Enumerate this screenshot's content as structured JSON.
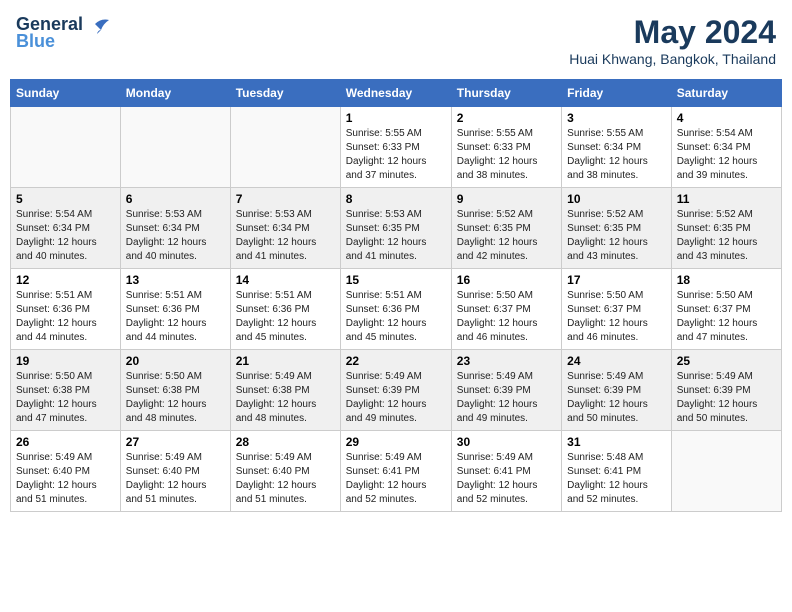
{
  "header": {
    "logo_general": "General",
    "logo_blue": "Blue",
    "month_title": "May 2024",
    "location": "Huai Khwang, Bangkok, Thailand"
  },
  "calendar": {
    "days_of_week": [
      "Sunday",
      "Monday",
      "Tuesday",
      "Wednesday",
      "Thursday",
      "Friday",
      "Saturday"
    ],
    "weeks": [
      [
        {
          "day": "",
          "info": ""
        },
        {
          "day": "",
          "info": ""
        },
        {
          "day": "",
          "info": ""
        },
        {
          "day": "1",
          "info": "Sunrise: 5:55 AM\nSunset: 6:33 PM\nDaylight: 12 hours\nand 37 minutes."
        },
        {
          "day": "2",
          "info": "Sunrise: 5:55 AM\nSunset: 6:33 PM\nDaylight: 12 hours\nand 38 minutes."
        },
        {
          "day": "3",
          "info": "Sunrise: 5:55 AM\nSunset: 6:34 PM\nDaylight: 12 hours\nand 38 minutes."
        },
        {
          "day": "4",
          "info": "Sunrise: 5:54 AM\nSunset: 6:34 PM\nDaylight: 12 hours\nand 39 minutes."
        }
      ],
      [
        {
          "day": "5",
          "info": "Sunrise: 5:54 AM\nSunset: 6:34 PM\nDaylight: 12 hours\nand 40 minutes."
        },
        {
          "day": "6",
          "info": "Sunrise: 5:53 AM\nSunset: 6:34 PM\nDaylight: 12 hours\nand 40 minutes."
        },
        {
          "day": "7",
          "info": "Sunrise: 5:53 AM\nSunset: 6:34 PM\nDaylight: 12 hours\nand 41 minutes."
        },
        {
          "day": "8",
          "info": "Sunrise: 5:53 AM\nSunset: 6:35 PM\nDaylight: 12 hours\nand 41 minutes."
        },
        {
          "day": "9",
          "info": "Sunrise: 5:52 AM\nSunset: 6:35 PM\nDaylight: 12 hours\nand 42 minutes."
        },
        {
          "day": "10",
          "info": "Sunrise: 5:52 AM\nSunset: 6:35 PM\nDaylight: 12 hours\nand 43 minutes."
        },
        {
          "day": "11",
          "info": "Sunrise: 5:52 AM\nSunset: 6:35 PM\nDaylight: 12 hours\nand 43 minutes."
        }
      ],
      [
        {
          "day": "12",
          "info": "Sunrise: 5:51 AM\nSunset: 6:36 PM\nDaylight: 12 hours\nand 44 minutes."
        },
        {
          "day": "13",
          "info": "Sunrise: 5:51 AM\nSunset: 6:36 PM\nDaylight: 12 hours\nand 44 minutes."
        },
        {
          "day": "14",
          "info": "Sunrise: 5:51 AM\nSunset: 6:36 PM\nDaylight: 12 hours\nand 45 minutes."
        },
        {
          "day": "15",
          "info": "Sunrise: 5:51 AM\nSunset: 6:36 PM\nDaylight: 12 hours\nand 45 minutes."
        },
        {
          "day": "16",
          "info": "Sunrise: 5:50 AM\nSunset: 6:37 PM\nDaylight: 12 hours\nand 46 minutes."
        },
        {
          "day": "17",
          "info": "Sunrise: 5:50 AM\nSunset: 6:37 PM\nDaylight: 12 hours\nand 46 minutes."
        },
        {
          "day": "18",
          "info": "Sunrise: 5:50 AM\nSunset: 6:37 PM\nDaylight: 12 hours\nand 47 minutes."
        }
      ],
      [
        {
          "day": "19",
          "info": "Sunrise: 5:50 AM\nSunset: 6:38 PM\nDaylight: 12 hours\nand 47 minutes."
        },
        {
          "day": "20",
          "info": "Sunrise: 5:50 AM\nSunset: 6:38 PM\nDaylight: 12 hours\nand 48 minutes."
        },
        {
          "day": "21",
          "info": "Sunrise: 5:49 AM\nSunset: 6:38 PM\nDaylight: 12 hours\nand 48 minutes."
        },
        {
          "day": "22",
          "info": "Sunrise: 5:49 AM\nSunset: 6:39 PM\nDaylight: 12 hours\nand 49 minutes."
        },
        {
          "day": "23",
          "info": "Sunrise: 5:49 AM\nSunset: 6:39 PM\nDaylight: 12 hours\nand 49 minutes."
        },
        {
          "day": "24",
          "info": "Sunrise: 5:49 AM\nSunset: 6:39 PM\nDaylight: 12 hours\nand 50 minutes."
        },
        {
          "day": "25",
          "info": "Sunrise: 5:49 AM\nSunset: 6:39 PM\nDaylight: 12 hours\nand 50 minutes."
        }
      ],
      [
        {
          "day": "26",
          "info": "Sunrise: 5:49 AM\nSunset: 6:40 PM\nDaylight: 12 hours\nand 51 minutes."
        },
        {
          "day": "27",
          "info": "Sunrise: 5:49 AM\nSunset: 6:40 PM\nDaylight: 12 hours\nand 51 minutes."
        },
        {
          "day": "28",
          "info": "Sunrise: 5:49 AM\nSunset: 6:40 PM\nDaylight: 12 hours\nand 51 minutes."
        },
        {
          "day": "29",
          "info": "Sunrise: 5:49 AM\nSunset: 6:41 PM\nDaylight: 12 hours\nand 52 minutes."
        },
        {
          "day": "30",
          "info": "Sunrise: 5:49 AM\nSunset: 6:41 PM\nDaylight: 12 hours\nand 52 minutes."
        },
        {
          "day": "31",
          "info": "Sunrise: 5:48 AM\nSunset: 6:41 PM\nDaylight: 12 hours\nand 52 minutes."
        },
        {
          "day": "",
          "info": ""
        }
      ]
    ]
  }
}
